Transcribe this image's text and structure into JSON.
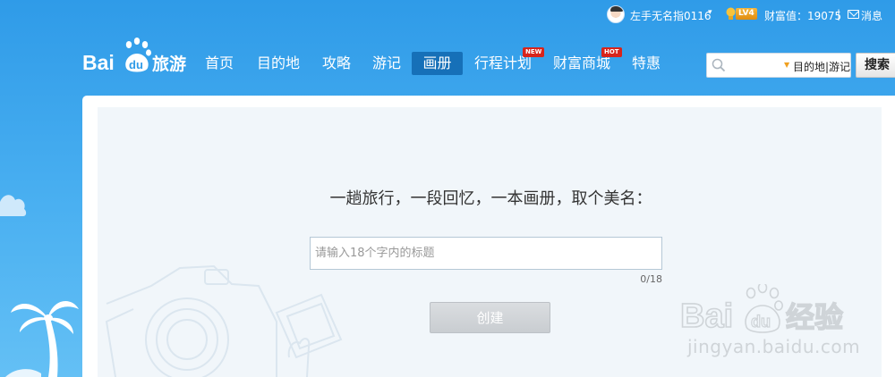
{
  "topbar": {
    "username": "左手无名指0116",
    "level": "LV4",
    "wealth_label": "财富值：19075",
    "separator": "|",
    "messages": "消息"
  },
  "logo": {
    "brand": "Baidu旅游"
  },
  "nav": {
    "items": [
      {
        "label": "首页"
      },
      {
        "label": "目的地"
      },
      {
        "label": "攻略"
      },
      {
        "label": "游记"
      },
      {
        "label": "画册",
        "active": true
      },
      {
        "label": "行程计划",
        "badge": "NEW"
      },
      {
        "label": "财富商城",
        "badge": "HOT"
      },
      {
        "label": "特惠"
      }
    ]
  },
  "search": {
    "placeholder": "",
    "scope": "目的地|游记",
    "button": "搜索"
  },
  "create_album": {
    "prompt": "一趟旅行，一段回忆，一本画册，取个美名：",
    "input_placeholder": "请输入18个字内的标题",
    "counter": "0/18",
    "button": "创建"
  },
  "watermark": {
    "brand": "Baidu经验",
    "url": "jingyan.baidu.com"
  },
  "colors": {
    "background": "#3aa5ee",
    "nav_active": "#1670b8",
    "badge_red": "#d8241c",
    "level_badge": "#f0a020"
  }
}
